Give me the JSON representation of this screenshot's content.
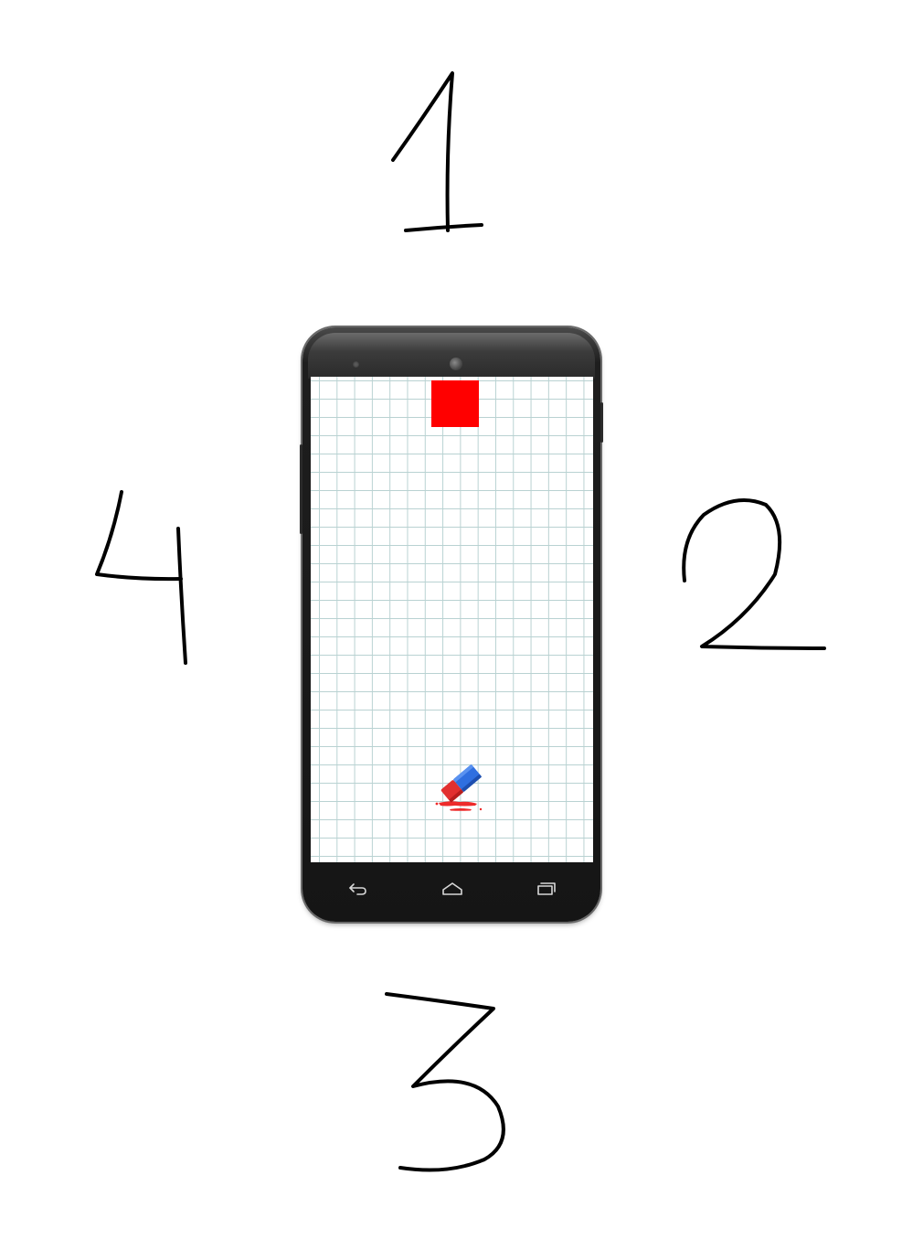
{
  "labels": {
    "top": "1",
    "right": "2",
    "bottom": "3",
    "left": "4"
  },
  "phone": {
    "screen": {
      "background": "#ffffff",
      "grid_color": "#b9d2d2",
      "block_color": "#ff0000",
      "eraser_icon": "eraser-icon"
    },
    "navbar": {
      "back_icon": "back-icon",
      "home_icon": "home-icon",
      "recents_icon": "recents-icon"
    }
  },
  "colors": {
    "eraser_blue": "#2f6fe0",
    "eraser_red": "#e83030",
    "phone_body": "#1e1e1e"
  }
}
